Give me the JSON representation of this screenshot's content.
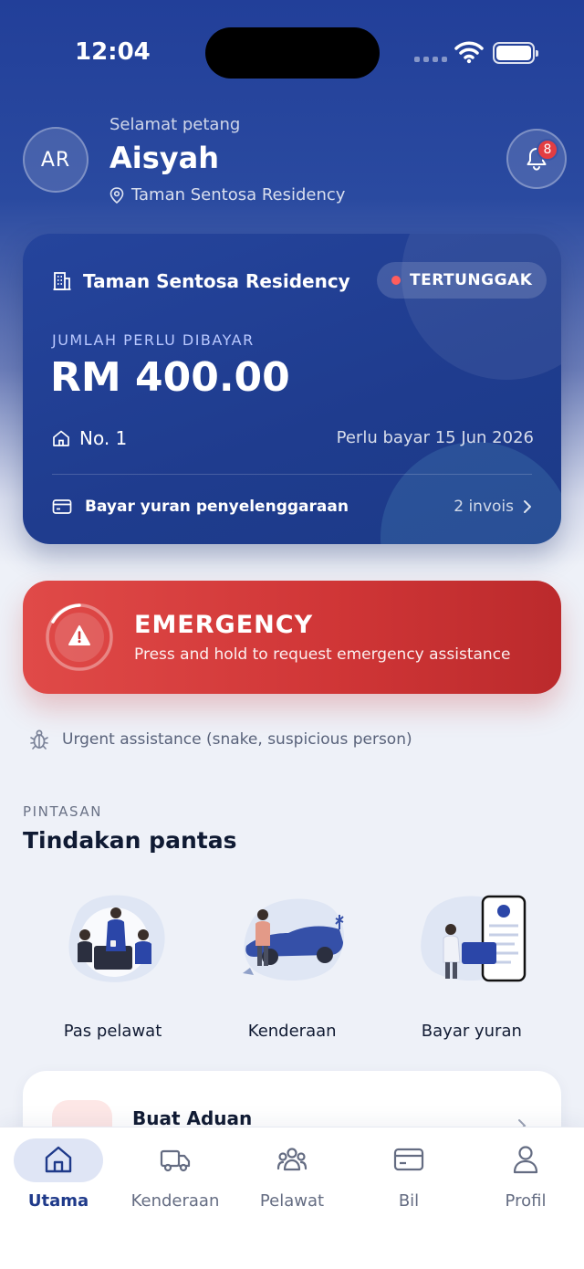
{
  "status_bar": {
    "time": "12:04"
  },
  "header": {
    "avatar_initials": "AR",
    "greeting": "Selamat petang",
    "user_name": "Aisyah",
    "location": "Taman Sentosa Residency",
    "notification_count": "8"
  },
  "bill_card": {
    "estate_name": "Taman Sentosa Residency",
    "status_label": "TERTUNGGAK",
    "amount_label": "JUMLAH PERLU DIBAYAR",
    "amount": "RM 400.00",
    "unit": "No. 1",
    "due_text": "Perlu bayar 15 Jun 2026",
    "pay_label": "Bayar yuran penyelenggaraan",
    "invoice_count": "2 invois"
  },
  "emergency": {
    "title": "EMERGENCY",
    "subtitle": "Press and hold to request emergency assistance",
    "hint": "Urgent assistance (snake, suspicious person)"
  },
  "shortcuts": {
    "section_label": "PINTASAN",
    "section_title": "Tindakan pantas",
    "items": [
      {
        "label": "Pas pelawat",
        "icon": "visitor-pass-illustration"
      },
      {
        "label": "Kenderaan",
        "icon": "vehicle-illustration"
      },
      {
        "label": "Bayar yuran",
        "icon": "pay-fee-illustration"
      }
    ]
  },
  "complaint": {
    "title": "Buat Aduan"
  },
  "bottom_nav": {
    "items": [
      {
        "label": "Utama",
        "icon": "home-icon",
        "active": true
      },
      {
        "label": "Kenderaan",
        "icon": "truck-icon",
        "active": false
      },
      {
        "label": "Pelawat",
        "icon": "group-icon",
        "active": false
      },
      {
        "label": "Bil",
        "icon": "card-icon",
        "active": false
      },
      {
        "label": "Profil",
        "icon": "user-icon",
        "active": false
      }
    ]
  },
  "colors": {
    "primary": "#223f99",
    "emergency": "#d63b3b",
    "overdue_dot": "#ff5d5d",
    "active_nav": "#1f3a8a"
  }
}
